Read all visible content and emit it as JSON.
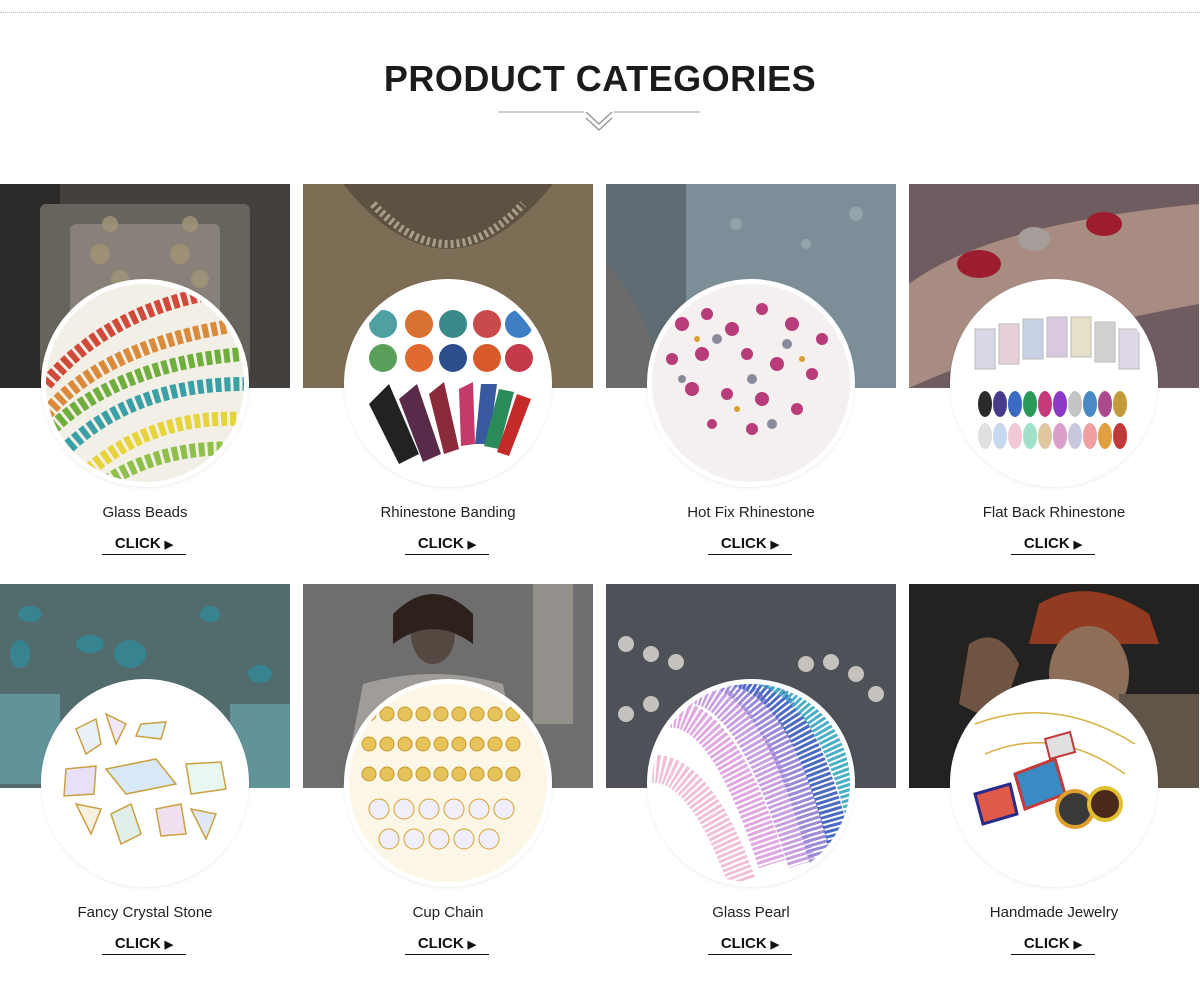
{
  "section": {
    "title": "PRODUCT CATEGORIES"
  },
  "categories": [
    {
      "label": "Glass Beads",
      "click": "CLICK"
    },
    {
      "label": "Rhinestone Banding",
      "click": "CLICK"
    },
    {
      "label": "Hot Fix Rhinestone",
      "click": "CLICK"
    },
    {
      "label": "Flat Back Rhinestone",
      "click": "CLICK"
    },
    {
      "label": "Fancy Crystal Stone",
      "click": "CLICK"
    },
    {
      "label": "Cup Chain",
      "click": "CLICK"
    },
    {
      "label": "Glass Pearl",
      "click": "CLICK"
    },
    {
      "label": "Handmade Jewelry",
      "click": "CLICK"
    }
  ],
  "icons": {
    "click_arrow": "play-triangle-icon",
    "divider": "double-chevron-down-icon"
  },
  "colors": {
    "title": "#1b1b1b",
    "background": "#ffffff",
    "overlay": "#4a4a4a"
  }
}
